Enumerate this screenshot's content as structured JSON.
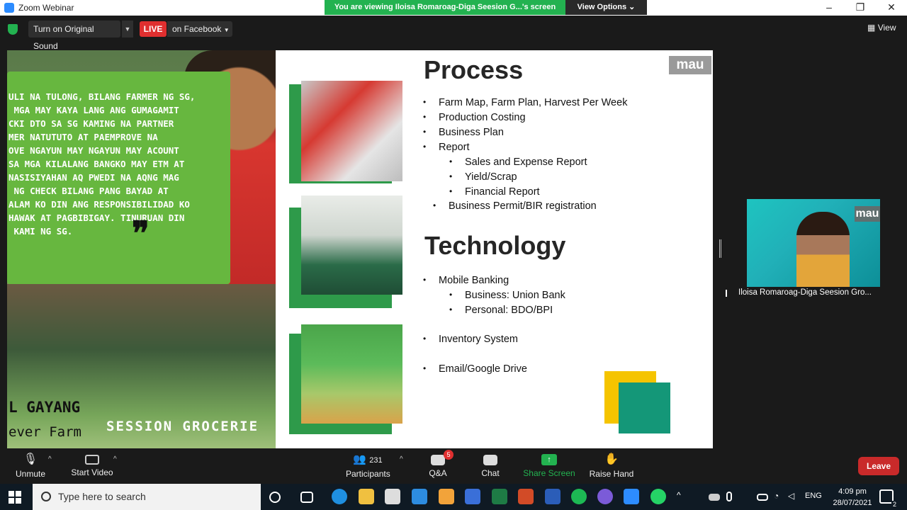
{
  "window": {
    "title": "Zoom Webinar",
    "viewing_banner": "You are viewing Iloisa Romaroag-Diga Seesion G...'s screen",
    "view_options": "View Options ⌄"
  },
  "topbar": {
    "original_sound": "Turn on Original Sound",
    "live": "LIVE",
    "facebook": "on Facebook",
    "view": "View"
  },
  "slide": {
    "quote": "ULI NA TULONG, BILANG FARMER NG SG,\n MGA MAY KAYA LANG ANG GUMAGAMIT\nCKI DTO SA SG KAMING NA PARTNER\nMER NATUTUTO AT PAEMPROVE NA\nOVE NGAYUN MAY NGAYUN MAY ACOUNT\nSA MGA KILALANG BANGKO MAY ETM AT\nNASISIYAHAN AQ PWEDI NA AQNG MAG\n NG CHECK BILANG PANG BAYAD AT\nALAM KO DIN ANG RESPONSIBILIDAD KO\nHAWAK AT PAGBIBIGAY. TINURUAN DIN\n KAMI NG SG.",
    "name": "L GAYANG",
    "farm": "ever Farm",
    "grocer": "SESSION GROCERIE",
    "logo": "mau",
    "process_title": "Process",
    "process_items": [
      "Farm Map, Farm Plan, Harvest Per Week",
      "Production Costing",
      "Business Plan",
      "Report"
    ],
    "report_items": [
      "Sales and Expense Report",
      "Yield/Scrap",
      "Financial Report"
    ],
    "permit": "Business Permit/BIR registration",
    "technology_title": "Technology",
    "tech_items": [
      "Mobile Banking",
      "Inventory System",
      "Email/Google Drive"
    ],
    "banking_items": [
      "Business: Union Bank",
      "Personal:  BDO/BPI"
    ]
  },
  "participant": {
    "name": "Iloisa Romaroag-Diga Seesion Gro...",
    "logo": "mau"
  },
  "toolbar": {
    "unmute": "Unmute",
    "start_video": "Start Video",
    "participants": "Participants",
    "participants_count": "231",
    "qa": "Q&A",
    "qa_badge": "5",
    "chat": "Chat",
    "share_screen": "Share Screen",
    "raise_hand": "Raise Hand",
    "leave": "Leave"
  },
  "taskbar": {
    "search": "Type here to search",
    "lang": "ENG",
    "time": "4:09 pm",
    "date": "28/07/2021",
    "notifications": "2"
  },
  "colors": {
    "live": "#e02f2f",
    "banner": "#23b250",
    "share_green": "#23b250",
    "leave": "#c92a2a"
  }
}
